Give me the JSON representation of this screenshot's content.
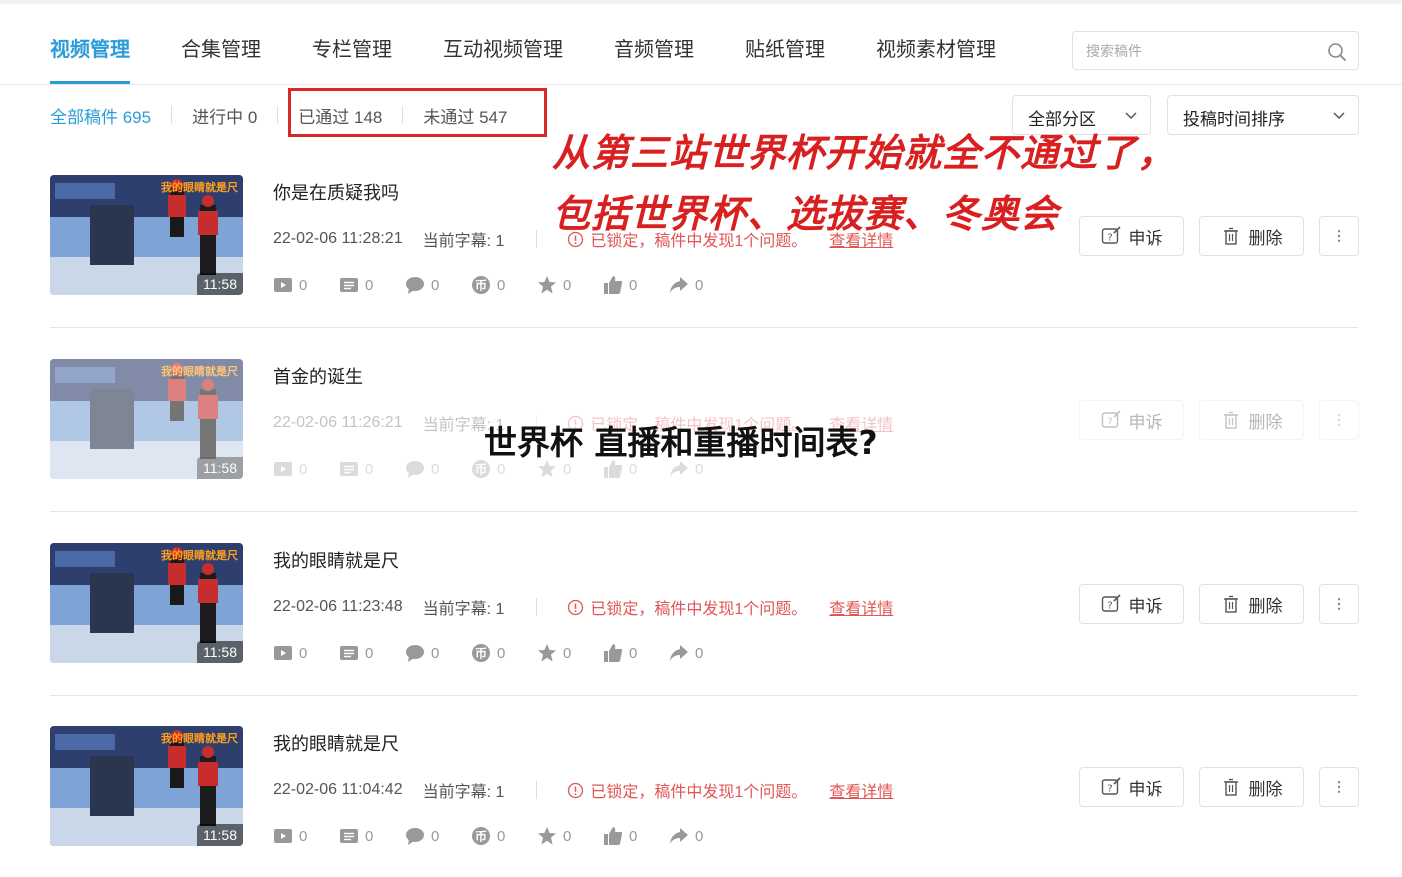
{
  "tabs": [
    {
      "label": "视频管理",
      "active": true
    },
    {
      "label": "合集管理"
    },
    {
      "label": "专栏管理"
    },
    {
      "label": "互动视频管理"
    },
    {
      "label": "音频管理"
    },
    {
      "label": "贴纸管理"
    },
    {
      "label": "视频素材管理"
    }
  ],
  "search": {
    "placeholder": "搜索稿件",
    "icon": "search-icon"
  },
  "filters": {
    "all": "全部稿件 695",
    "in_progress": "进行中 0",
    "passed": "已通过 148",
    "rejected": "未通过 547"
  },
  "dropdowns": {
    "category": "全部分区",
    "sort": "投稿时间排序"
  },
  "annotation": {
    "line1": "从第三站世界杯开始就全不通过了，",
    "line2": "包括世界杯、选拔赛、冬奥会"
  },
  "overlay_title": "世界杯 直播和重播时间表?",
  "thumb_caption": "我的眼睛就是尺",
  "rows": [
    {
      "title": "你是在质疑我吗",
      "date": "22-02-06 11:28:21",
      "subtitle": "当前字幕: 1",
      "status": "已锁定，稿件中发现1个问题。",
      "link": "查看详情",
      "duration": "11:58",
      "stats": [
        "0",
        "0",
        "0",
        "0",
        "0",
        "0",
        "0"
      ],
      "appeal": "申诉",
      "delete": "删除"
    },
    {
      "title": "首金的诞生",
      "date": "22-02-06 11:26:21",
      "subtitle": "当前字幕: 1",
      "status": "已锁定，稿件中发现1个问题。",
      "link": "查看详情",
      "duration": "11:58",
      "stats": [
        "0",
        "0",
        "0",
        "0",
        "0",
        "0",
        "0"
      ],
      "appeal": "申诉",
      "delete": "删除"
    },
    {
      "title": "我的眼睛就是尺",
      "date": "22-02-06 11:23:48",
      "subtitle": "当前字幕: 1",
      "status": "已锁定，稿件中发现1个问题。",
      "link": "查看详情",
      "duration": "11:58",
      "stats": [
        "0",
        "0",
        "0",
        "0",
        "0",
        "0",
        "0"
      ],
      "appeal": "申诉",
      "delete": "删除"
    },
    {
      "title": "我的眼睛就是尺",
      "date": "22-02-06 11:04:42",
      "subtitle": "当前字幕: 1",
      "status": "已锁定，稿件中发现1个问题。",
      "link": "查看详情",
      "duration": "11:58",
      "stats": [
        "0",
        "0",
        "0",
        "0",
        "0",
        "0",
        "0"
      ],
      "appeal": "申诉",
      "delete": "删除"
    }
  ],
  "colors": {
    "accent": "#2b9cd8",
    "warning": "#e05555",
    "annotation": "#d92020"
  }
}
